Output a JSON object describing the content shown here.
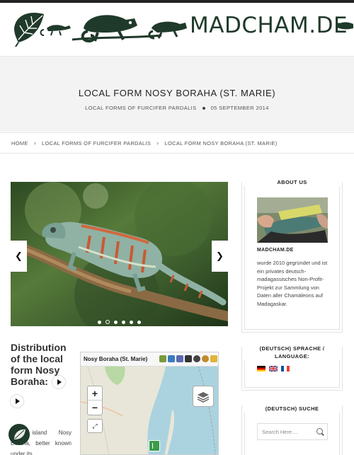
{
  "site": {
    "logo_text": "MADCHAM.DE"
  },
  "page": {
    "title": "LOCAL FORM NOSY BORAHA (ST. MARIE)",
    "category": "LOCAL FORMS OF FURCIFER PARDALIS",
    "date": "05 SEPTEMBER 2014"
  },
  "breadcrumb": {
    "items": [
      "HOME",
      "LOCAL FORMS OF FURCIFER PARDALIS",
      "LOCAL FORM NOSY BORAHA (ST. MARIE)"
    ]
  },
  "slider": {
    "prev_icon": "chevron-left-icon",
    "next_icon": "chevron-right-icon",
    "dot_count": 6,
    "active_dot": 1
  },
  "content": {
    "distribution_heading": "Distribution of the local form Nosy Boraha:",
    "paragraph": "The island Nosy Boraha, better known under its"
  },
  "map": {
    "title": "Nosy Boraha (St. Marie)",
    "zoom_in": "+",
    "zoom_out": "−",
    "fullscreen_icon": "⤢"
  },
  "sidebar": {
    "about": {
      "title": "ABOUT US",
      "name": "MADCHAM.DE",
      "text": "wurde 2010 gegründet und ist ein privates deutsch-madagassisches Non-Profit-Projekt zur Sammlung von Daten aller Chamäleons auf Madagaskar."
    },
    "language": {
      "title": "(DEUTSCH) SPRACHE / LANGUAGE:",
      "flags": [
        "de",
        "gb",
        "fr"
      ]
    },
    "search": {
      "title": "(DEUTSCH) SUCHE",
      "placeholder": "Search Here...."
    }
  },
  "colors": {
    "brand_green": "#1f3a2a",
    "header_bar": "#222222",
    "title_band": "#f3f3f3"
  }
}
